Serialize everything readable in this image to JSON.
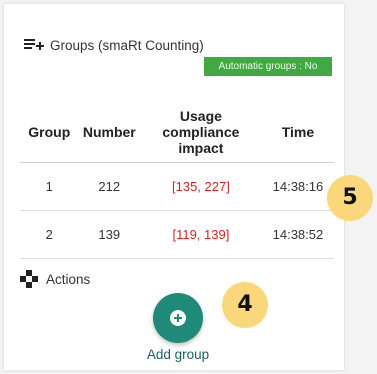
{
  "groups_section": {
    "title": "Groups (smaRt Counting)",
    "auto_badge": "Automatic groups : No",
    "columns": [
      "Group",
      "Number",
      "Usage compliance impact",
      "Time"
    ],
    "rows": [
      {
        "group": "1",
        "number": "212",
        "usage": "[135, 227]",
        "time": "14:38:16"
      },
      {
        "group": "2",
        "number": "139",
        "usage": "[119, 139]",
        "time": "14:38:52"
      }
    ]
  },
  "actions_section": {
    "title": "Actions",
    "add_group_label": "Add group"
  },
  "markers": {
    "marker_5": "5",
    "marker_4": "4"
  },
  "colors": {
    "badge_green": "#41a844",
    "usage_red": "#d62323",
    "fab_teal": "#1f8a78",
    "marker_yellow": "#f9d77a"
  },
  "icons": [
    "list-add-icon",
    "gamepad-icon",
    "plus-circle-icon"
  ]
}
